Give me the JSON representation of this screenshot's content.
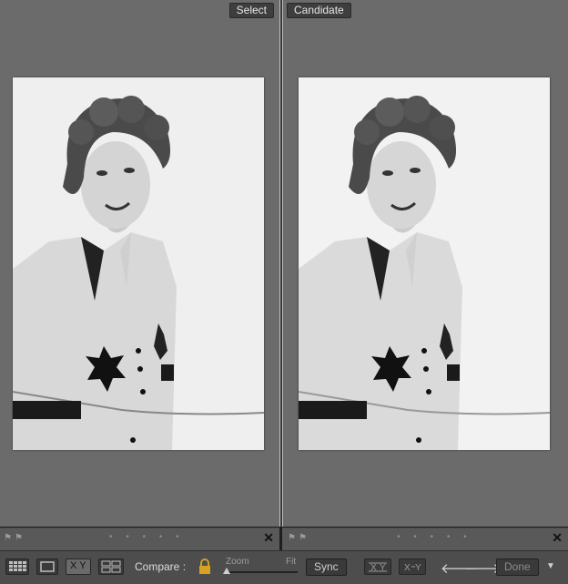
{
  "panes": {
    "left": {
      "tag": "Select"
    },
    "right": {
      "tag": "Candidate"
    }
  },
  "filmstrip": {
    "dots": "• • • • •",
    "close_icon": "✕",
    "flag_icon": "⚑"
  },
  "toolbar": {
    "compare_label": "Compare :",
    "zoom_label": "Zoom",
    "fit_label": "Fit",
    "sync_label": "Sync",
    "done_label": "Done",
    "xy_label": "X Y",
    "prev_arrow": "🡐",
    "next_arrow": "🡒",
    "dropdown_arrow": "▼",
    "zoom_level": 0
  },
  "colors": {
    "pane_bg": "#6b6b6b",
    "toolbar_bg": "#4d4d4d",
    "tag_bg": "#3e3e3e"
  }
}
